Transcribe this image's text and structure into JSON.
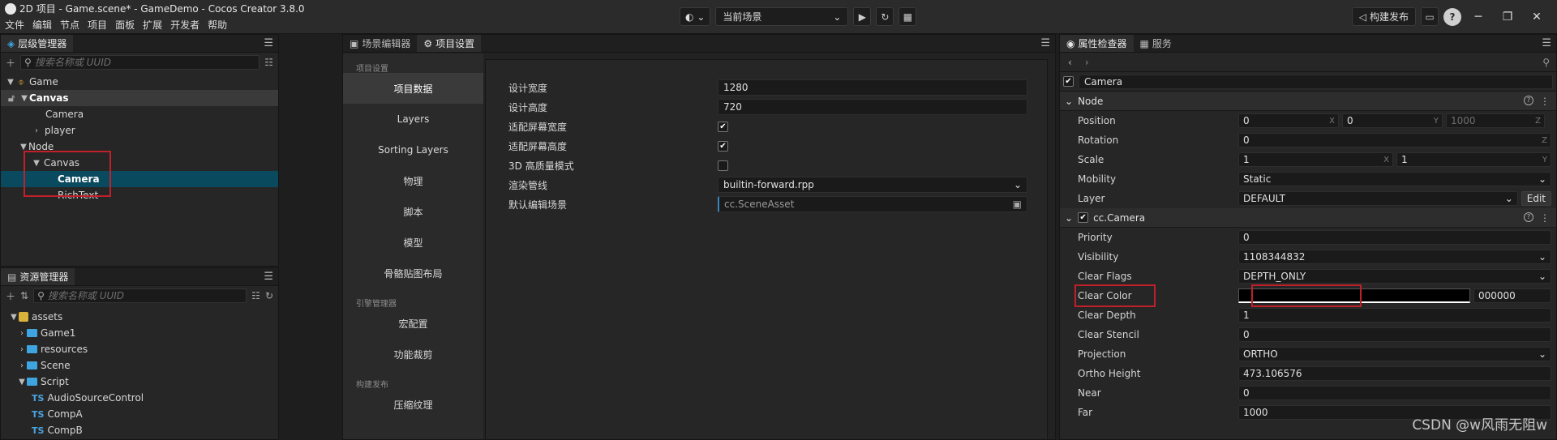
{
  "window": {
    "title": "2D 项目 - Game.scene* - GameDemo - Cocos Creator 3.8.0",
    "menu": [
      "文件",
      "编辑",
      "节点",
      "项目",
      "面板",
      "扩展",
      "开发者",
      "帮助"
    ],
    "scene_select": "当前场景",
    "build_button": "构建发布",
    "help": "?"
  },
  "hierarchy": {
    "tab": "层级管理器",
    "search_placeholder": "搜索名称或 UUID",
    "items": [
      {
        "label": "Game",
        "depth": 0
      },
      {
        "label": "Canvas",
        "depth": 0
      },
      {
        "label": "Camera",
        "depth": 1
      },
      {
        "label": "player",
        "depth": 1
      },
      {
        "label": "Node",
        "depth": 0
      },
      {
        "label": "Canvas",
        "depth": 1
      },
      {
        "label": "Camera",
        "depth": 2
      },
      {
        "label": "RichText",
        "depth": 2
      }
    ]
  },
  "assets": {
    "tab": "资源管理器",
    "search_placeholder": "搜索名称或 UUID",
    "items": [
      {
        "label": "assets"
      },
      {
        "label": "Game1"
      },
      {
        "label": "resources"
      },
      {
        "label": "Scene"
      },
      {
        "label": "Script"
      },
      {
        "label": "AudioSourceControl",
        "ts": "TS"
      },
      {
        "label": "CompA",
        "ts": "TS"
      },
      {
        "label": "CompB",
        "ts": "TS"
      }
    ]
  },
  "center": {
    "tabs": [
      "场景编辑器",
      "项目设置"
    ],
    "sidebar": {
      "group1": "项目设置",
      "items1": [
        "项目数据",
        "Layers",
        "Sorting Layers",
        "物理",
        "脚本",
        "模型",
        "骨骼贴图布局"
      ],
      "group2": "引擎管理器",
      "items2": [
        "宏配置",
        "功能裁剪"
      ],
      "group3": "构建发布",
      "items3": [
        "压缩纹理"
      ]
    },
    "settings": {
      "design_width_label": "设计宽度",
      "design_width": "1280",
      "design_height_label": "设计高度",
      "design_height": "720",
      "fit_width_label": "适配屏幕宽度",
      "fit_height_label": "适配屏幕高度",
      "hq_label": "3D 高质量模式",
      "pipeline_label": "渲染管线",
      "pipeline": "builtin-forward.rpp",
      "default_scene_label": "默认编辑场景",
      "default_scene": "cc.SceneAsset"
    }
  },
  "inspector": {
    "tabs": [
      "属性检查器",
      "服务"
    ],
    "node_name": "Camera",
    "node_section": "Node",
    "position_label": "Position",
    "position": {
      "x": "0",
      "y": "0",
      "z": "1000"
    },
    "rotation_label": "Rotation",
    "rotation": "0",
    "scale_label": "Scale",
    "scale": {
      "x": "1",
      "y": "1"
    },
    "mobility_label": "Mobility",
    "mobility": "Static",
    "layer_label": "Layer",
    "layer": "DEFAULT",
    "edit": "Edit",
    "camera_section": "cc.Camera",
    "priority_label": "Priority",
    "priority": "0",
    "visibility_label": "Visibility",
    "visibility": "1108344832",
    "clear_flags_label": "Clear Flags",
    "clear_flags": "DEPTH_ONLY",
    "clear_color_label": "Clear Color",
    "clear_color_hex": "000000",
    "clear_depth_label": "Clear Depth",
    "clear_depth": "1",
    "clear_stencil_label": "Clear Stencil",
    "clear_stencil": "0",
    "projection_label": "Projection",
    "projection": "ORTHO",
    "ortho_height_label": "Ortho Height",
    "ortho_height": "473.106576",
    "near_label": "Near",
    "near": "0",
    "far_label": "Far",
    "far": "1000",
    "axis_x": "X",
    "axis_y": "Y",
    "axis_z": "Z"
  },
  "watermark": "CSDN @w风雨无阻w"
}
